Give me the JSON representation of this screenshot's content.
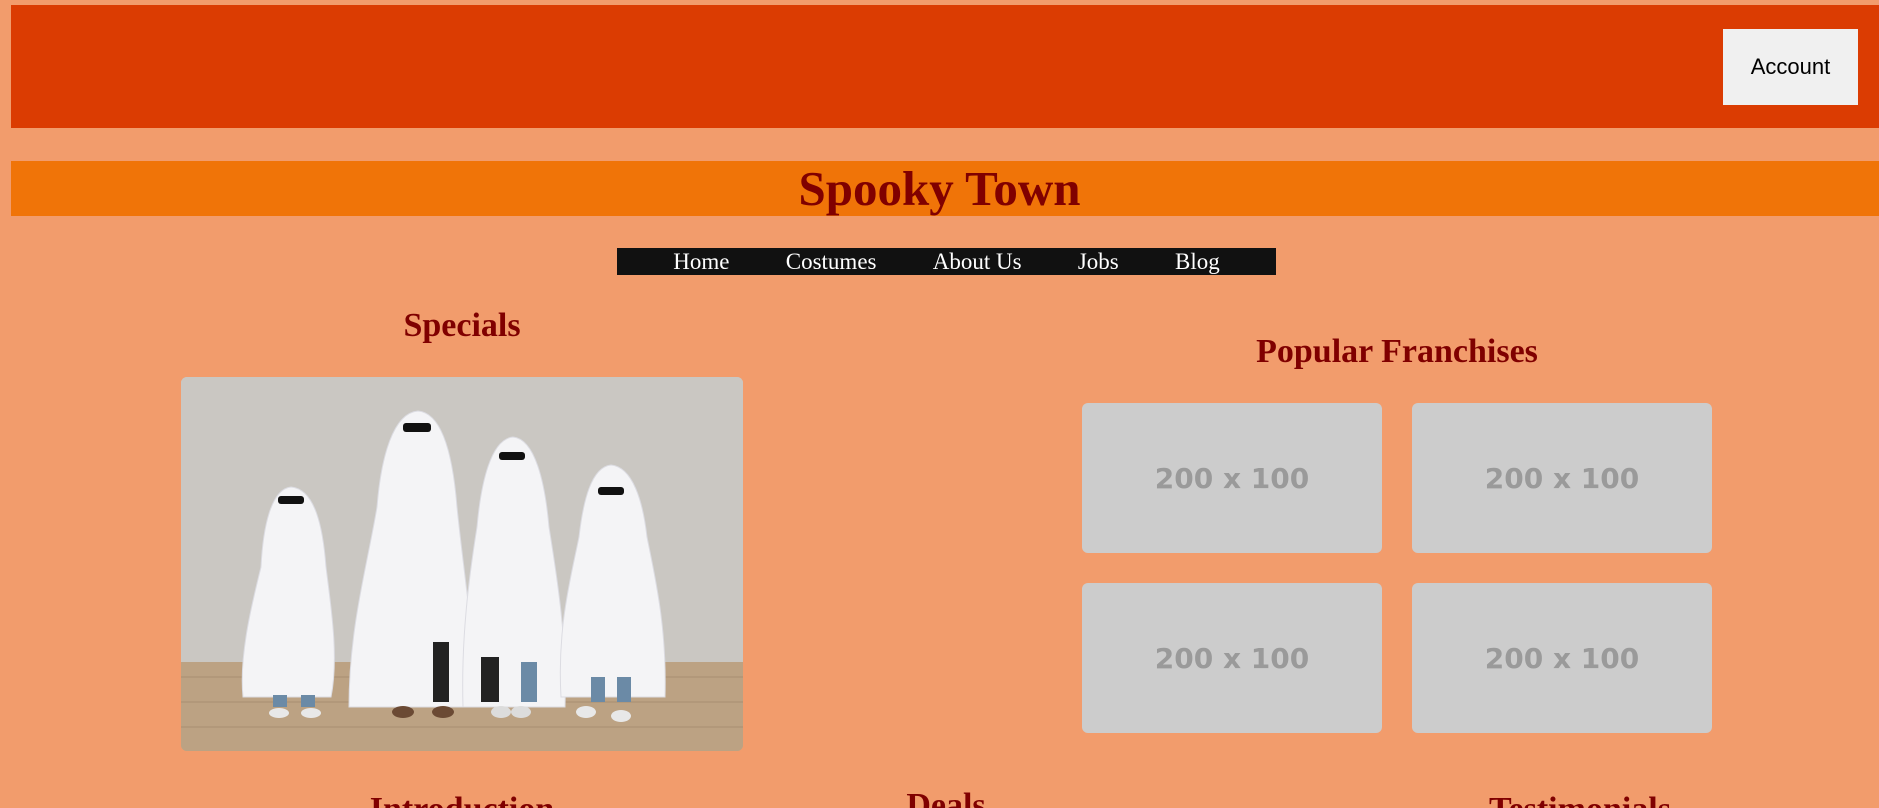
{
  "header": {
    "account_label": "Account"
  },
  "site": {
    "title": "Spooky Town"
  },
  "nav": {
    "items": [
      {
        "label": "Home"
      },
      {
        "label": "Costumes"
      },
      {
        "label": "About Us"
      },
      {
        "label": "Jobs"
      },
      {
        "label": "Blog"
      }
    ]
  },
  "specials": {
    "heading": "Specials",
    "image_alt": "Four people dressed as ghosts wearing sunglasses"
  },
  "franchises": {
    "heading": "Popular Franchises",
    "tiles": [
      {
        "label": "200 x 100"
      },
      {
        "label": "200 x 100"
      },
      {
        "label": "200 x 100"
      },
      {
        "label": "200 x 100"
      }
    ]
  },
  "lower_sections": {
    "introduction": "Introduction",
    "deals": "Deals",
    "testimonials": "Testimonials"
  },
  "colors": {
    "page_bg": "#f29c6c",
    "topbar": "#db3c02",
    "title_band": "#f07408",
    "heading_text": "#800000",
    "nav_bg": "#111111"
  }
}
